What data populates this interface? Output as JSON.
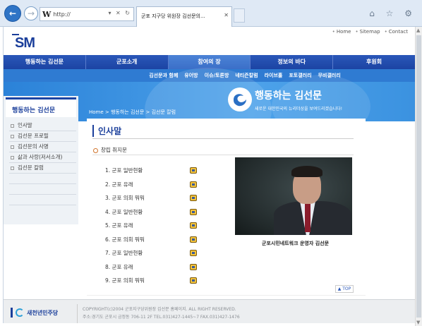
{
  "browser": {
    "url": "http://",
    "tab_title": "군포 지구당 위원장 김선문의...",
    "tab_close": "✕",
    "addr_controls": "▾ ✕ ↻",
    "back_glyph": "←",
    "fwd_glyph": "→",
    "right_icons": "⌂ ☆ ⚙"
  },
  "header": {
    "logo": "SM",
    "toplinks": [
      "Home",
      "Sitemap",
      "Contact"
    ]
  },
  "mainnav": [
    "행동하는 김선문",
    "군포소개",
    "참여의 장",
    "정보의 바다",
    "후원회"
  ],
  "subnav": [
    "김선문과 함께",
    "유어방",
    "이슈/토론방",
    "네티즌칼럼",
    "라이브홀",
    "포토갤러리",
    "무비갤러리"
  ],
  "banner": {
    "title": "행동하는 김선문",
    "subtitle": "새로운 대한민국의 뉴리더상을 보여드리겠습니다!"
  },
  "sidebar": {
    "heading": "행동하는 김선문",
    "items": [
      {
        "label": "인사말"
      },
      {
        "label": "김선문 프로필"
      },
      {
        "label": "김선문의 사명"
      },
      {
        "label": "삶과 사랑(저서소개)"
      },
      {
        "label": "김선문 칼럼"
      }
    ]
  },
  "breadcrumb": "Home > 행동하는 김선문 > 김선문 칼럼",
  "page": {
    "title": "인사말",
    "section": "창립 취지문",
    "list": [
      "1. 군포 일반현황",
      "2. 군포 유래",
      "3. 군포 의회 뭐뭐",
      "4. 군포 일반현황",
      "5. 군포 유래",
      "6. 군포 의회 뭐뭐",
      "7. 군포 일반현황",
      "8. 군포 유래",
      "9. 군포 의회 뭐뭐"
    ],
    "photo_caption": "군포시민네트워크 운영자 김선문",
    "top_button": "▲ TOP"
  },
  "footer": {
    "party": "새천년민주당",
    "copyright": "COPYRIGHT(c)2004 군포지구당위원장 김선문 홈페이지. ALL RIGHT RESERVED.",
    "address": "주소:경기도 군포시 금정동 706-11 2F TEL.031)427-1445~7   FAX.031)427-1476"
  },
  "colors": {
    "brand": "#1b3f9b",
    "nav": "#1c44a3",
    "subnav": "#2f7bd2"
  }
}
